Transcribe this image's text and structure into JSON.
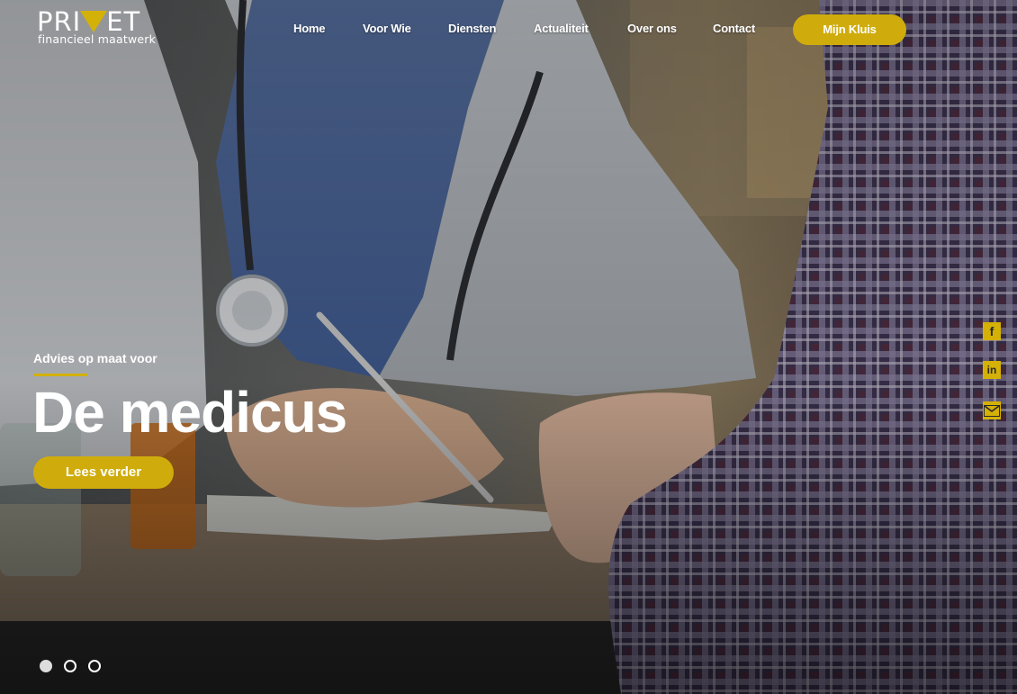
{
  "brand": {
    "wordmark_left": "PRI",
    "wordmark_right": "ET",
    "tagline": "financieel maatwerk",
    "accent_color": "#d4b106"
  },
  "nav": {
    "items": [
      {
        "label": "Home"
      },
      {
        "label": "Voor Wie"
      },
      {
        "label": "Diensten"
      },
      {
        "label": "Actualiteit"
      },
      {
        "label": "Over ons"
      },
      {
        "label": "Contact"
      }
    ],
    "cta_label": "Mijn Kluis"
  },
  "hero": {
    "subtitle": "Advies op maat voor",
    "title": "De medicus",
    "button_label": "Lees verder",
    "slides": [
      {
        "active": true
      },
      {
        "active": false
      },
      {
        "active": false
      }
    ]
  },
  "social": [
    {
      "icon": "facebook-icon",
      "glyph": "f"
    },
    {
      "icon": "linkedin-icon",
      "glyph": "in"
    },
    {
      "icon": "mail-icon",
      "glyph": ""
    }
  ]
}
